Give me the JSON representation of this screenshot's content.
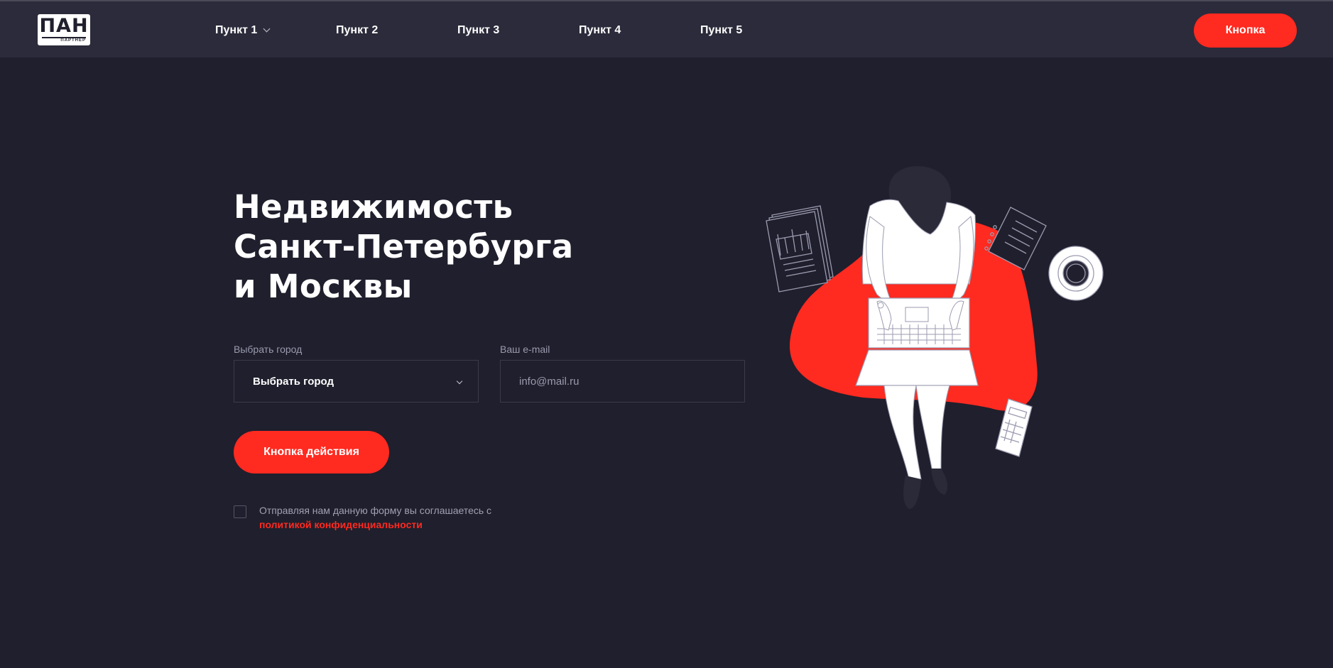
{
  "header": {
    "logo": {
      "main": "ПАН",
      "sub": "ПАРТНЁР"
    },
    "nav": [
      {
        "label": "Пункт 1",
        "has_dropdown": true
      },
      {
        "label": "Пункт 2"
      },
      {
        "label": "Пункт 3"
      },
      {
        "label": "Пункт 4"
      },
      {
        "label": "Пункт 5"
      }
    ],
    "button_label": "Кнопка"
  },
  "hero": {
    "title_lines": [
      "Недвижимость",
      "Санкт-Петербурга",
      "и Москвы"
    ],
    "form": {
      "city_label": "Выбрать город",
      "city_value": "Выбрать город",
      "email_label": "Ваш e-mail",
      "email_placeholder": "info@mail.ru",
      "submit_label": "Кнопка действия",
      "consent_text": "Отправляя нам данную форму вы соглашаетесь с",
      "consent_link": "политикой конфиденциальности",
      "consent_checked": false
    }
  },
  "illustration": {
    "icon": "woman-with-laptop-illustration",
    "accent_color": "#ff2a20"
  },
  "colors": {
    "background": "#1f1f2d",
    "header_background": "#2b2b3b",
    "accent": "#ff2a20",
    "muted_text": "#9a9aae"
  }
}
